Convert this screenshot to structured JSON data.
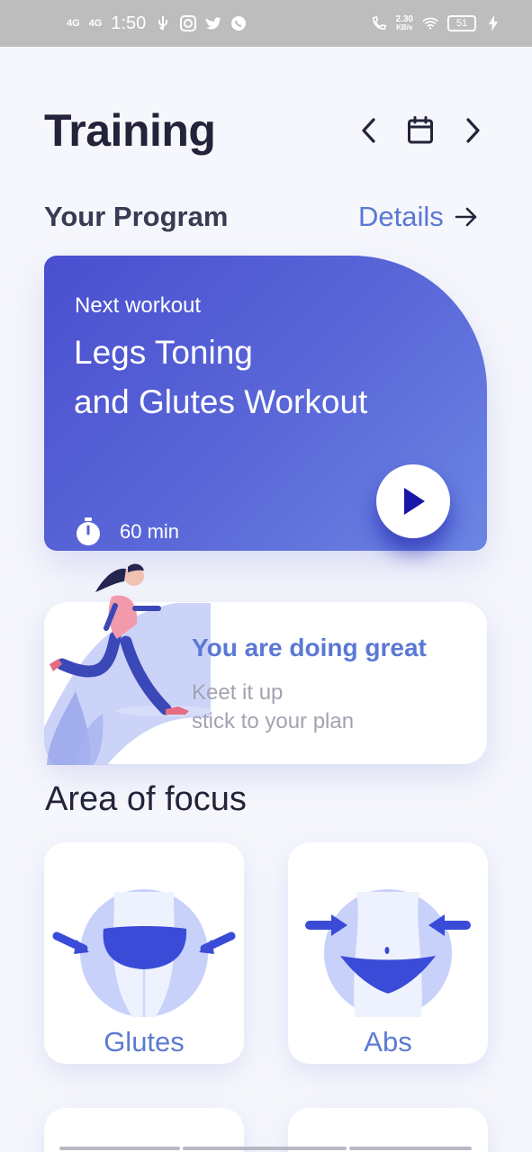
{
  "status_bar": {
    "network_1": "4G",
    "network_2": "4G",
    "time": "1:50",
    "speed_value": "2.30",
    "speed_unit": "KB/s",
    "battery": "51",
    "icons": [
      "usb-icon",
      "instagram-icon",
      "twitter-icon",
      "whatsapp-icon",
      "call-icon",
      "wifi-icon",
      "charging-icon"
    ]
  },
  "header": {
    "title": "Training",
    "icons": [
      "chevron-left-icon",
      "calendar-icon",
      "chevron-right-icon"
    ]
  },
  "program": {
    "section_title": "Your Program",
    "details_label": "Details",
    "card": {
      "kicker": "Next workout",
      "title_line1": "Legs Toning",
      "title_line2": "and Glutes Workout",
      "duration": "60 min"
    }
  },
  "encouragement": {
    "title": "You are doing great",
    "line1": "Keet it up",
    "line2": "stick to your plan"
  },
  "focus": {
    "title": "Area of focus",
    "items": [
      {
        "label": "Glutes"
      },
      {
        "label": "Abs"
      }
    ]
  },
  "colors": {
    "accent": "#5b78d4",
    "card_gradient_start": "#4a4fcf",
    "card_gradient_end": "#6c86e4",
    "play_icon": "#1a17a8",
    "title_text": "#24233a"
  }
}
